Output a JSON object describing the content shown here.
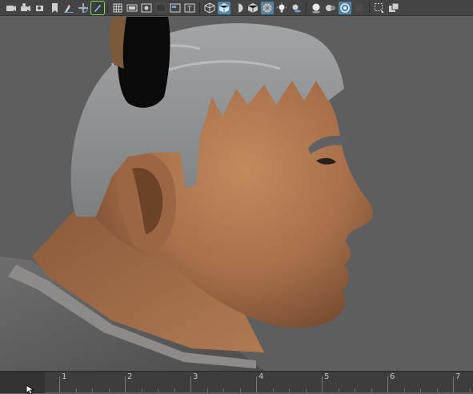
{
  "toolbar": {
    "icons": [
      "camera-select-icon",
      "camera-attributes-icon",
      "bookmarks-icon",
      "image-plane-icon",
      "grease-pencil-icon",
      "2d-pan-zoom-icon",
      "grease-pencil-active-icon",
      "grid-icon",
      "film-gate-icon",
      "resolution-gate-icon",
      "gate-mask-icon",
      "field-chart-icon",
      "safe-action-icon",
      "safe-title-icon",
      "wireframe-icon",
      "smooth-shade-icon",
      "default-material-icon",
      "wireframe-on-shaded-icon",
      "xray-icon",
      "use-all-lights-icon",
      "shadows-icon",
      "ambient-occlusion-icon",
      "motion-blur-icon",
      "anti-aliasing-icon",
      "depth-of-field-icon",
      "isolate-select-icon",
      "xray-joints-icon"
    ]
  },
  "timeline": {
    "frames": [
      "1",
      "2",
      "3",
      "4",
      "5",
      "6",
      "7"
    ]
  },
  "colors": {
    "viewport_bg": "#5e5e5e",
    "toolbar_bg": "#444444",
    "accent": "#5285a6",
    "skin": "#b07a52",
    "hair": "#8f9193"
  }
}
